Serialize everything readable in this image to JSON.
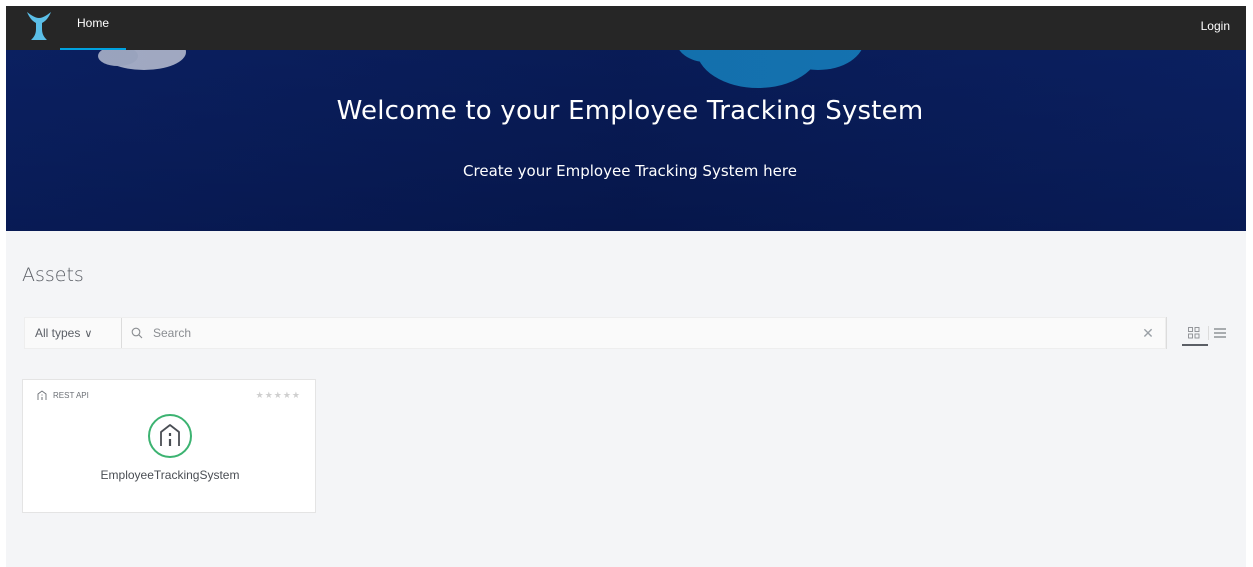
{
  "nav": {
    "home_label": "Home",
    "login_label": "Login"
  },
  "hero": {
    "title": "Welcome to your Employee Tracking System",
    "subtitle": "Create your Employee Tracking System here"
  },
  "assets": {
    "title": "Assets",
    "type_filter": "All types",
    "search_placeholder": "Search",
    "search_value": "",
    "view_mode": "grid"
  },
  "cards": [
    {
      "type": "REST API",
      "name": "EmployeeTrackingSystem",
      "rating": 0,
      "rating_max": 5,
      "icon": "rest-api-icon"
    }
  ],
  "colors": {
    "accent": "#00a2df",
    "nav_bg": "#262626",
    "hero_bg": "#0a1e5c",
    "card_icon_ring": "#3cb371"
  }
}
